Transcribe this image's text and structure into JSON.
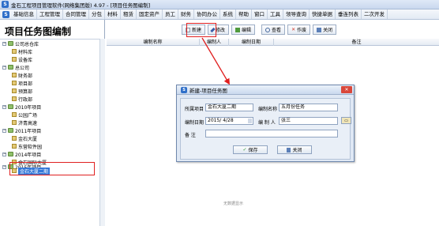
{
  "window": {
    "title": "金石工程项目管理软件(网络集团版) 4.97 - [项目任务图编制]"
  },
  "menu": [
    "基础信息",
    "工程管理",
    "合同管理",
    "分包",
    "材料",
    "租赁",
    "固定资产",
    "员工",
    "财务",
    "协同办公",
    "系统",
    "帮助",
    "窗口",
    "工具",
    "领导查询",
    "快捷单据",
    "垂连列表",
    "二次开发"
  ],
  "page": {
    "title": "项目任务图编制"
  },
  "toolbar": {
    "new": "新建",
    "edit": "修改",
    "compile": "编辑",
    "view": "查看",
    "void": "作废",
    "close": "关闭"
  },
  "tree": {
    "nodes": [
      {
        "label": "公司总仓库",
        "kind": "group",
        "expander": "−"
      },
      {
        "label": "材料库",
        "kind": "leaf"
      },
      {
        "label": "设备库",
        "kind": "leaf"
      },
      {
        "label": "总公司",
        "kind": "group",
        "expander": "−"
      },
      {
        "label": "财务部",
        "kind": "leaf"
      },
      {
        "label": "项目部",
        "kind": "leaf"
      },
      {
        "label": "预算部",
        "kind": "leaf"
      },
      {
        "label": "行政部",
        "kind": "leaf"
      },
      {
        "label": "2010年项目",
        "kind": "group",
        "expander": "−"
      },
      {
        "label": "公园广场",
        "kind": "leaf"
      },
      {
        "label": "济青高速",
        "kind": "leaf"
      },
      {
        "label": "2011年项目",
        "kind": "group",
        "expander": "−"
      },
      {
        "label": "金石大厦",
        "kind": "leaf"
      },
      {
        "label": "东营软件园",
        "kind": "leaf"
      },
      {
        "label": "2014年项目",
        "kind": "group",
        "expander": "−"
      },
      {
        "label": "金石国际大厦",
        "kind": "leaf"
      },
      {
        "label": "2015年项目",
        "kind": "group",
        "expander": "−"
      },
      {
        "label": "金石大厦二期",
        "kind": "leaf",
        "selected": true
      }
    ]
  },
  "grid": {
    "columns": [
      "编制名称",
      "编制人",
      "编制日期",
      "备注"
    ],
    "empty_note": "无数据显示"
  },
  "dialog": {
    "title": "新建-项目任务图",
    "project_label": "所属项目",
    "project_value": "金石大厦二期",
    "name_label": "编制名称",
    "name_value": "五月份任务",
    "date_label": "编制日期",
    "date_value": "2015/ 4/28",
    "person_label": "编 制 人",
    "person_value": "张三",
    "note_label": "备    注",
    "note_value": "",
    "save_label": "保存",
    "close_label": "关闭"
  }
}
